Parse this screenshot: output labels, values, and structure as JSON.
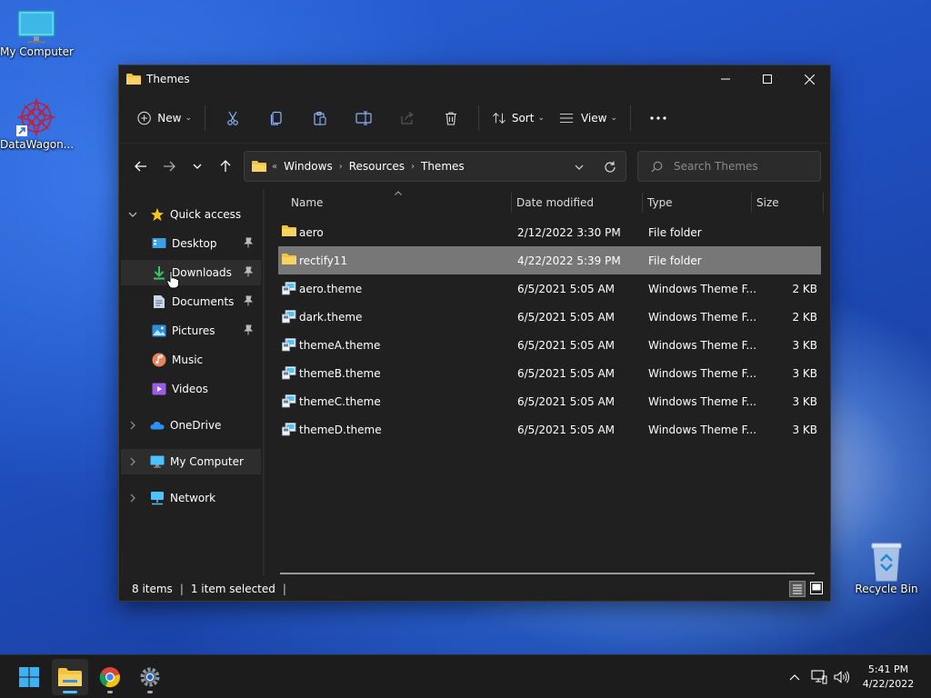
{
  "desktop": {
    "icons": [
      {
        "label": "My Computer",
        "icon": "monitor-icon"
      },
      {
        "label": "DataWagon...",
        "icon": "datawagon-shortcut-icon"
      },
      {
        "label": "Recycle Bin",
        "icon": "recycle-bin-icon"
      }
    ]
  },
  "window": {
    "title": "Themes",
    "toolbar": {
      "new_label": "New",
      "sort_label": "Sort",
      "view_label": "View",
      "more_label": "..."
    },
    "address": {
      "overflow": "«",
      "crumbs": [
        "Windows",
        "Resources",
        "Themes"
      ]
    },
    "search": {
      "placeholder": "Search Themes"
    },
    "sidebar": {
      "quick_access": "Quick access",
      "items": [
        {
          "label": "Desktop",
          "icon": "desktop-icon",
          "pinned": true
        },
        {
          "label": "Downloads",
          "icon": "download-icon",
          "pinned": true
        },
        {
          "label": "Documents",
          "icon": "documents-icon",
          "pinned": true
        },
        {
          "label": "Pictures",
          "icon": "pictures-icon",
          "pinned": true
        },
        {
          "label": "Music",
          "icon": "music-icon",
          "pinned": false
        },
        {
          "label": "Videos",
          "icon": "videos-icon",
          "pinned": false
        }
      ],
      "onedrive": "OneDrive",
      "my_computer": "My Computer",
      "network": "Network"
    },
    "columns": {
      "name": "Name",
      "date": "Date modified",
      "type": "Type",
      "size": "Size"
    },
    "files": [
      {
        "name": "aero",
        "date": "2/12/2022 3:30 PM",
        "type": "File folder",
        "size": "",
        "kind": "folder"
      },
      {
        "name": "rectify11",
        "date": "4/22/2022 5:39 PM",
        "type": "File folder",
        "size": "",
        "kind": "folder",
        "selected": true
      },
      {
        "name": "aero.theme",
        "date": "6/5/2021 5:05 AM",
        "type": "Windows Theme F...",
        "size": "2 KB",
        "kind": "theme"
      },
      {
        "name": "dark.theme",
        "date": "6/5/2021 5:05 AM",
        "type": "Windows Theme F...",
        "size": "2 KB",
        "kind": "theme"
      },
      {
        "name": "themeA.theme",
        "date": "6/5/2021 5:05 AM",
        "type": "Windows Theme F...",
        "size": "3 KB",
        "kind": "theme"
      },
      {
        "name": "themeB.theme",
        "date": "6/5/2021 5:05 AM",
        "type": "Windows Theme F...",
        "size": "3 KB",
        "kind": "theme"
      },
      {
        "name": "themeC.theme",
        "date": "6/5/2021 5:05 AM",
        "type": "Windows Theme F...",
        "size": "3 KB",
        "kind": "theme"
      },
      {
        "name": "themeD.theme",
        "date": "6/5/2021 5:05 AM",
        "type": "Windows Theme F...",
        "size": "3 KB",
        "kind": "theme"
      }
    ],
    "status": {
      "items": "8 items",
      "selected": "1 item selected"
    }
  },
  "taskbar": {
    "apps": [
      "start-icon",
      "file-explorer-icon",
      "chrome-icon",
      "settings-icon"
    ],
    "clock": {
      "time": "5:41 PM",
      "date": "4/22/2022"
    }
  },
  "colors": {
    "window_bg": "#202020",
    "selection": "#777777",
    "accent": "#4cc2ff",
    "folder": "#f3c43f"
  }
}
